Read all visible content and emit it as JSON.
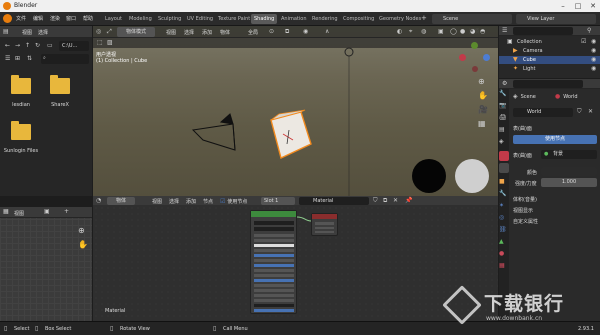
{
  "window": {
    "title": "Blender"
  },
  "menu": [
    "文件",
    "编辑",
    "渲染",
    "窗口",
    "帮助"
  ],
  "workspaces": [
    "Layout",
    "Modeling",
    "Sculpting",
    "UV Editing",
    "Texture Paint",
    "Shading",
    "Animation",
    "Rendering",
    "Compositing",
    "Geometry Nodes"
  ],
  "active_workspace": "Shading",
  "scene": {
    "label": "Scene"
  },
  "view_layer": {
    "label": "View Layer"
  },
  "file_browser": {
    "menu": [
      "视图",
      "选择"
    ],
    "path": "C:\\U...",
    "items": [
      {
        "name": "lesdian"
      },
      {
        "name": "ShareX"
      },
      {
        "name": "Sunlogin Files"
      }
    ]
  },
  "viewport": {
    "mode": "物体模式",
    "menus": [
      "视图",
      "选择",
      "添加",
      "物体"
    ],
    "orientation": "全局",
    "overlay_line1": "用户透视",
    "overlay_line2": "(1) Collection | Cube",
    "select_label": "选项"
  },
  "outliner": {
    "items": [
      {
        "name": "Collection"
      },
      {
        "name": "Camera"
      },
      {
        "name": "Cube"
      },
      {
        "name": "Light"
      }
    ]
  },
  "properties": {
    "scene_tab": "Scene",
    "world_tab": "World",
    "world_name": "World",
    "surface_header": "表(曲)面",
    "use_nodes": "使用节点",
    "surface_label": "表(曲)面",
    "surface_value": "背景",
    "color_label": "颜色",
    "strength_label": "强度/力度",
    "strength_value": "1.000",
    "volume_header": "体积(音量)",
    "viewport_display": "视图显示",
    "custom_props": "自定义属性"
  },
  "image_editor": {
    "menu": [
      "视图"
    ]
  },
  "node_editor": {
    "type": "物体",
    "menus": [
      "视图",
      "选择",
      "添加",
      "节点"
    ],
    "use_nodes": "使用节点",
    "slot": "Slot 1",
    "material": "Material",
    "label": "Material"
  },
  "statusbar": {
    "select": "Select",
    "box_select": "Box Select",
    "rotate_view": "Rotate View",
    "call_menu": "Call Menu",
    "version": "2.93.1"
  },
  "watermark": {
    "cn": "下载银行",
    "url": "www.downbank.cn"
  }
}
